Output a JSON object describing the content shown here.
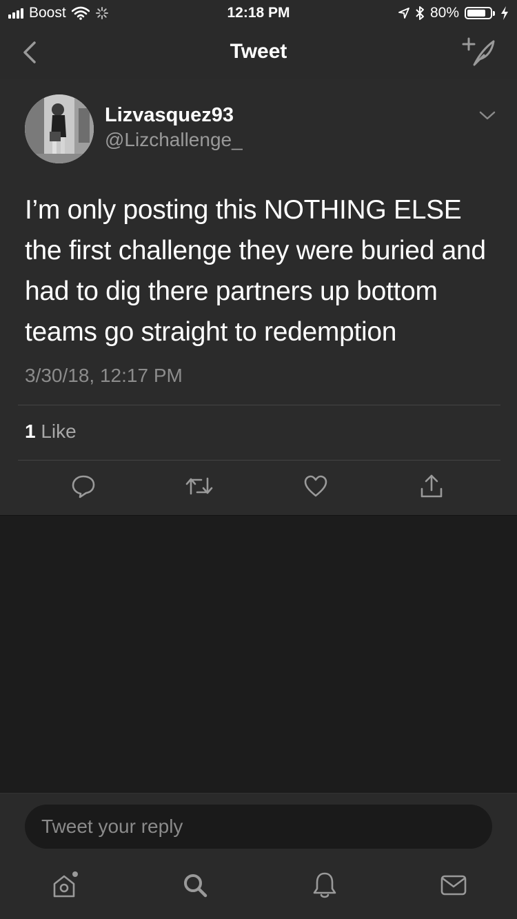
{
  "status_bar": {
    "carrier": "Boost",
    "time": "12:18 PM",
    "battery": "80%",
    "battery_level": 0.8
  },
  "nav": {
    "title": "Tweet",
    "back_icon": "chevron-left-icon",
    "compose_icon": "compose-tweet-icon"
  },
  "tweet": {
    "display_name": "Lizvasquez93",
    "handle": "@Lizchallenge_",
    "text": "I’m only posting this NOTHING ELSE the first challenge they were buried and had to dig there partners up bottom teams go straight to redemption",
    "timestamp": "3/30/18, 12:17 PM",
    "like_count": "1",
    "like_label": "Like"
  },
  "actions": [
    "reply-icon",
    "retweet-icon",
    "like-icon",
    "share-icon"
  ],
  "reply": {
    "placeholder": "Tweet your reply"
  },
  "tabs": [
    "home-icon",
    "search-icon",
    "notifications-icon",
    "messages-icon"
  ],
  "colors": {
    "background": "#1c1c1c",
    "card": "#2b2b2b",
    "bars": "#2a2a2a",
    "secondary_text": "#9a9a9a"
  }
}
